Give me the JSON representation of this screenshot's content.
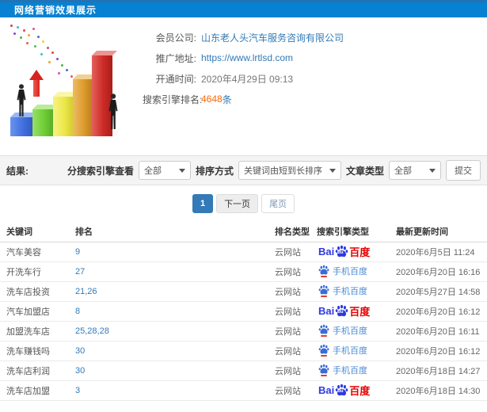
{
  "header": {
    "title": "网络营销效果展示",
    "bg_color": "#0781d1"
  },
  "info": {
    "company_label": "会员公司:",
    "company_value": "山东老人头汽车服务咨询有限公司",
    "url_label": "推广地址:",
    "url_value": "https://www.lrtlsd.com",
    "open_time_label": "开通时间:",
    "open_time_value": "2020年4月29日 09:13",
    "rank_count_label": "搜索引擎排名:",
    "rank_count_value": "4648",
    "rank_count_suffix": "条"
  },
  "filters": {
    "result_label": "结果:",
    "engine_label": "分搜索引擎查看",
    "engine_value": "全部",
    "sort_label": "排序方式",
    "sort_value": "关键词由短到长排序",
    "article_label": "文章类型",
    "article_value": "全部",
    "submit_label": "提交"
  },
  "pagination": {
    "current": "1",
    "next": "下一页",
    "last": "尾页"
  },
  "logos": {
    "pc": {
      "bai": "Bai",
      "du": "du",
      "cn": "百度",
      "blue": "#2d39e0",
      "red": "#e60000"
    },
    "mobile": {
      "text": "手机百度",
      "blue": "#3a6bd8"
    }
  },
  "table": {
    "headers": [
      "关键词",
      "排名",
      "排名类型",
      "搜索引擎类型",
      "最新更新时间"
    ],
    "rows": [
      {
        "keyword": "汽车美容",
        "rank": "9",
        "rank_type": "云网站",
        "engine": "baidu-pc",
        "time": "2020年6月5日 11:24"
      },
      {
        "keyword": "开洗车行",
        "rank": "27",
        "rank_type": "云网站",
        "engine": "baidu-mobile",
        "time": "2020年6月20日 16:16"
      },
      {
        "keyword": "洗车店投资",
        "rank": "21,26",
        "rank_type": "云网站",
        "engine": "baidu-mobile",
        "time": "2020年5月27日 14:58"
      },
      {
        "keyword": "汽车加盟店",
        "rank": "8",
        "rank_type": "云网站",
        "engine": "baidu-pc",
        "time": "2020年6月20日 16:12"
      },
      {
        "keyword": "加盟洗车店",
        "rank": "25,28,28",
        "rank_type": "云网站",
        "engine": "baidu-mobile",
        "time": "2020年6月20日 16:11"
      },
      {
        "keyword": "洗车赚钱吗",
        "rank": "30",
        "rank_type": "云网站",
        "engine": "baidu-mobile",
        "time": "2020年6月20日 16:12"
      },
      {
        "keyword": "洗车店利润",
        "rank": "30",
        "rank_type": "云网站",
        "engine": "baidu-mobile",
        "time": "2020年6月18日 14:27"
      },
      {
        "keyword": "洗车店加盟",
        "rank": "3",
        "rank_type": "云网站",
        "engine": "baidu-pc",
        "time": "2020年6月18日 14:30"
      }
    ]
  },
  "colors": {
    "link": "#337ab7",
    "count_orange": "#ff6600",
    "filter_bg": "#f4f4f4"
  }
}
